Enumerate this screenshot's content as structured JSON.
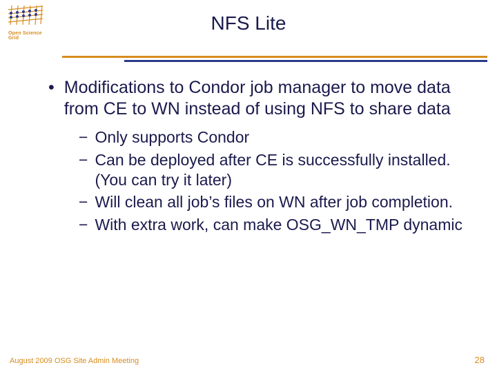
{
  "logo_label": "Open Science Grid",
  "title": "NFS Lite",
  "main_bullet": "Modifications to Condor job manager to move data from CE to WN instead of using NFS to share data",
  "sub_bullets": [
    "Only supports Condor",
    "Can be deployed after CE is successfully installed. (You can try it later)",
    "Will clean all job’s files on WN after job completion.",
    "With extra work, can make OSG_WN_TMP dynamic"
  ],
  "footer_text": "August 2009 OSG Site Admin Meeting",
  "slide_number": "28"
}
